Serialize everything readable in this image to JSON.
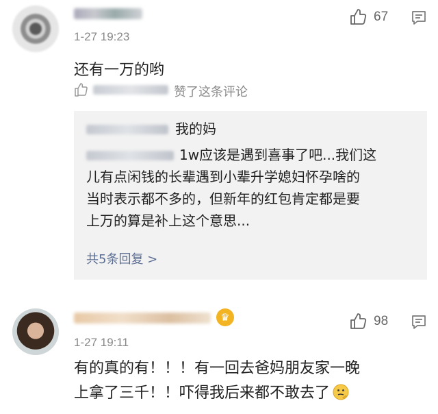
{
  "comments": [
    {
      "time": "1-27 19:23",
      "likes": "67",
      "text": "还有一万的哟",
      "liked_by_suffix": "赞了这条评论",
      "replies": {
        "line1_text": "我的妈",
        "line2_text": "1w应该是遇到喜事了吧...我们这",
        "line3_text": "儿有点闲钱的长辈遇到小辈升学媳妇怀孕啥的",
        "line4_text": "当时表示都不多的，但新年的红包肯定都是要",
        "line5_text": "上万的算是补上这个意思...",
        "more_label": "共5条回复 >"
      }
    },
    {
      "time": "1-27 19:11",
      "likes": "98",
      "text_line1": "有的真的有！！！有一回去爸妈朋友家一晚",
      "text_line2": "上拿了三千！！吓得我后来都不敢去了"
    }
  ]
}
